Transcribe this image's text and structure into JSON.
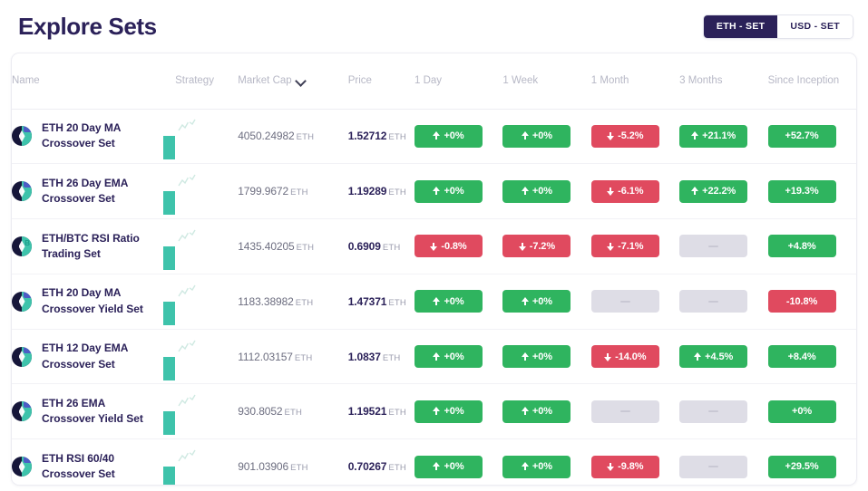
{
  "header": {
    "title": "Explore Sets",
    "toggle": {
      "options": [
        {
          "label": "ETH - SET",
          "active": true
        },
        {
          "label": "USD - SET",
          "active": false
        }
      ]
    }
  },
  "colors": {
    "accent_navy": "#2b2159",
    "positive_green": "#2fb45f",
    "negative_red": "#e04a5f",
    "neutral_gray": "#dedde6",
    "token_teal": "#3ec3ab"
  },
  "table": {
    "columns": [
      {
        "key": "name",
        "label": "Name"
      },
      {
        "key": "strategy",
        "label": "Strategy"
      },
      {
        "key": "market_cap",
        "label": "Market Cap",
        "sort_icon": "chevron-down-icon",
        "sorted": true
      },
      {
        "key": "price",
        "label": "Price"
      },
      {
        "key": "d1",
        "label": "1 Day"
      },
      {
        "key": "w1",
        "label": "1 Week"
      },
      {
        "key": "m1",
        "label": "1 Month"
      },
      {
        "key": "m3",
        "label": "3 Months"
      },
      {
        "key": "inception",
        "label": "Since Inception"
      }
    ],
    "rows": [
      {
        "name_line1": "ETH 20 Day MA",
        "name_line2": "Crossover Set",
        "token_icon": "eth-token-icon",
        "strategy_icon": "strategy-chart-icon",
        "market_cap": "4050.24982",
        "market_cap_unit": "ETH",
        "price": "1.52712",
        "price_unit": "ETH",
        "perf": [
          {
            "value": "+0%",
            "dir": "up"
          },
          {
            "value": "+0%",
            "dir": "up"
          },
          {
            "value": "-5.2%",
            "dir": "down"
          },
          {
            "value": "+21.1%",
            "dir": "up"
          },
          {
            "value": "+52.7%",
            "dir": "flat-up"
          }
        ]
      },
      {
        "name_line1": "ETH 26 Day EMA",
        "name_line2": "Crossover Set",
        "token_icon": "eth-token-icon",
        "strategy_icon": "strategy-chart-icon",
        "market_cap": "1799.9672",
        "market_cap_unit": "ETH",
        "price": "1.19289",
        "price_unit": "ETH",
        "perf": [
          {
            "value": "+0%",
            "dir": "up"
          },
          {
            "value": "+0%",
            "dir": "up"
          },
          {
            "value": "-6.1%",
            "dir": "down"
          },
          {
            "value": "+22.2%",
            "dir": "up"
          },
          {
            "value": "+19.3%",
            "dir": "flat-up"
          }
        ]
      },
      {
        "name_line1": "ETH/BTC RSI Ratio",
        "name_line2": "Trading Set",
        "token_icon": "eth-btc-token-icon",
        "strategy_icon": "strategy-chart-icon",
        "market_cap": "1435.40205",
        "market_cap_unit": "ETH",
        "price": "0.6909",
        "price_unit": "ETH",
        "perf": [
          {
            "value": "-0.8%",
            "dir": "down"
          },
          {
            "value": "-7.2%",
            "dir": "down"
          },
          {
            "value": "-7.1%",
            "dir": "down"
          },
          {
            "value": "—",
            "dir": "none"
          },
          {
            "value": "+4.8%",
            "dir": "flat-up"
          }
        ]
      },
      {
        "name_line1": "ETH 20 Day MA",
        "name_line2": "Crossover Yield Set",
        "token_icon": "eth-token-icon",
        "strategy_icon": "strategy-chart-icon",
        "market_cap": "1183.38982",
        "market_cap_unit": "ETH",
        "price": "1.47371",
        "price_unit": "ETH",
        "perf": [
          {
            "value": "+0%",
            "dir": "up"
          },
          {
            "value": "+0%",
            "dir": "up"
          },
          {
            "value": "—",
            "dir": "none"
          },
          {
            "value": "—",
            "dir": "none"
          },
          {
            "value": "-10.8%",
            "dir": "flat-down"
          }
        ]
      },
      {
        "name_line1": "ETH 12 Day EMA",
        "name_line2": "Crossover Set",
        "token_icon": "eth-token-icon",
        "strategy_icon": "strategy-chart-icon",
        "market_cap": "1112.03157",
        "market_cap_unit": "ETH",
        "price": "1.0837",
        "price_unit": "ETH",
        "perf": [
          {
            "value": "+0%",
            "dir": "up"
          },
          {
            "value": "+0%",
            "dir": "up"
          },
          {
            "value": "-14.0%",
            "dir": "down"
          },
          {
            "value": "+4.5%",
            "dir": "up"
          },
          {
            "value": "+8.4%",
            "dir": "flat-up"
          }
        ]
      },
      {
        "name_line1": "ETH 26 EMA",
        "name_line2": "Crossover Yield Set",
        "token_icon": "eth-token-icon",
        "strategy_icon": "strategy-chart-icon",
        "market_cap": "930.8052",
        "market_cap_unit": "ETH",
        "price": "1.19521",
        "price_unit": "ETH",
        "perf": [
          {
            "value": "+0%",
            "dir": "up"
          },
          {
            "value": "+0%",
            "dir": "up"
          },
          {
            "value": "—",
            "dir": "none"
          },
          {
            "value": "—",
            "dir": "none"
          },
          {
            "value": "+0%",
            "dir": "flat-up"
          }
        ]
      },
      {
        "name_line1": "ETH RSI 60/40",
        "name_line2": "Crossover Set",
        "token_icon": "eth-token-icon",
        "strategy_icon": "strategy-chart-icon",
        "market_cap": "901.03906",
        "market_cap_unit": "ETH",
        "price": "0.70267",
        "price_unit": "ETH",
        "perf": [
          {
            "value": "+0%",
            "dir": "up"
          },
          {
            "value": "+0%",
            "dir": "up"
          },
          {
            "value": "-9.8%",
            "dir": "down"
          },
          {
            "value": "—",
            "dir": "none"
          },
          {
            "value": "+29.5%",
            "dir": "flat-up"
          }
        ]
      }
    ]
  }
}
